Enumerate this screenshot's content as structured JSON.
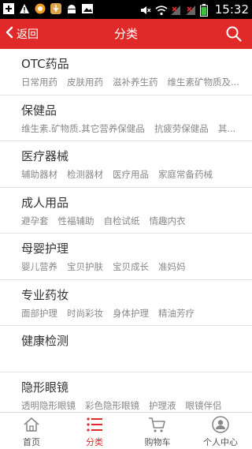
{
  "statusbar": {
    "time": "15:32"
  },
  "header": {
    "back_label": "返回",
    "title": "分类"
  },
  "categories": [
    {
      "title": "OTC药品",
      "subs": [
        "日常用药",
        "皮肤用药",
        "滋补养生药",
        "维生素矿物质及..."
      ]
    },
    {
      "title": "保健品",
      "subs": [
        "维生素.矿物质.其它营养保健品",
        "抗疲劳保健品",
        "其..."
      ]
    },
    {
      "title": "医疗器械",
      "subs": [
        "辅助器材",
        "检测器材",
        "医疗用品",
        "家庭常备药械"
      ]
    },
    {
      "title": "成人用品",
      "subs": [
        "避孕套",
        "性福辅助",
        "自检试纸",
        "情趣内衣"
      ]
    },
    {
      "title": "母婴护理",
      "subs": [
        "婴儿营养",
        "宝贝护肤",
        "宝贝成长",
        "准妈妈"
      ]
    },
    {
      "title": "专业药妆",
      "subs": [
        "面部护理",
        "时尚彩妆",
        "身体护理",
        "精油芳疗"
      ]
    },
    {
      "title": "健康检测",
      "subs": []
    },
    {
      "title": "隐形眼镜",
      "subs": [
        "透明隐形眼镜",
        "彩色隐形眼镜",
        "护理液",
        "眼镜伴侣"
      ]
    }
  ],
  "nav": {
    "home": "首页",
    "category": "分类",
    "cart": "购物车",
    "profile": "个人中心"
  },
  "colors": {
    "accent": "#e02a2a"
  }
}
